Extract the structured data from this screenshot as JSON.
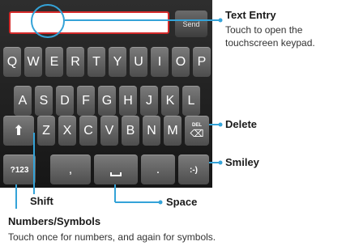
{
  "keyboard": {
    "send_label": "Send",
    "row1": [
      "Q",
      "W",
      "E",
      "R",
      "T",
      "Y",
      "U",
      "I",
      "O",
      "P"
    ],
    "row2": [
      "A",
      "S",
      "D",
      "F",
      "G",
      "H",
      "J",
      "K",
      "L"
    ],
    "row3": [
      "Z",
      "X",
      "C",
      "V",
      "B",
      "N",
      "M"
    ],
    "del_label": "DEL",
    "numbers_label": "?123",
    "comma_label": ",",
    "period_label": ".",
    "smiley_label": ":-)"
  },
  "annotations": {
    "text_entry_title": "Text Entry",
    "text_entry_desc_1": "Touch to open the",
    "text_entry_desc_2": "touchscreen keypad.",
    "delete": "Delete",
    "smiley": "Smiley",
    "shift": "Shift",
    "space": "Space",
    "numbers_title": "Numbers/Symbols",
    "numbers_desc": "Touch once for numbers, and again for symbols."
  },
  "colors": {
    "callout_line": "#34a3d8",
    "entry_border": "#d42a2a"
  }
}
